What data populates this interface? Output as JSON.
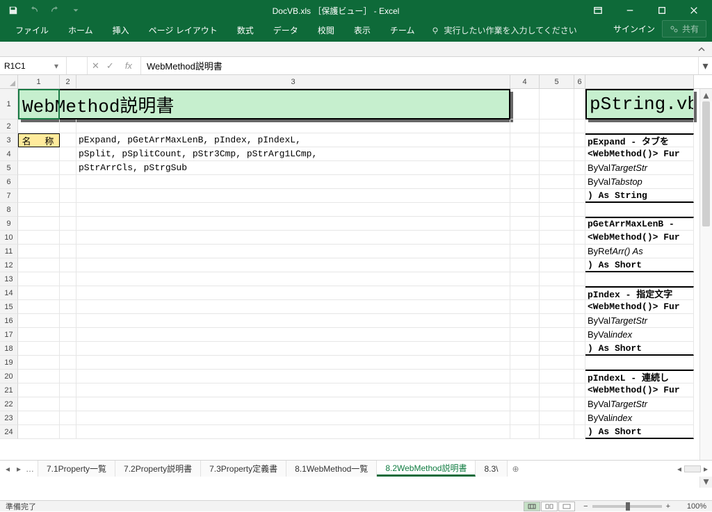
{
  "titlebar": {
    "title": "DocVB.xls ［保護ビュー］ - Excel"
  },
  "ribbon": {
    "tabs": [
      "ファイル",
      "ホーム",
      "挿入",
      "ページ レイアウト",
      "数式",
      "データ",
      "校閲",
      "表示",
      "チーム"
    ],
    "tellme": "実行したい作業を入力してください",
    "signin": "サインイン",
    "share": "共有"
  },
  "formula_bar": {
    "namebox": "R1C1",
    "formula": "WebMethod説明書"
  },
  "columns": [
    "1",
    "2",
    "3",
    "4",
    "5",
    "6"
  ],
  "row_headers": [
    "1",
    "2",
    "3",
    "4",
    "5",
    "6",
    "7",
    "8",
    "9",
    "10",
    "11",
    "12",
    "13",
    "14",
    "15",
    "16",
    "17",
    "18",
    "19",
    "20",
    "21",
    "22",
    "23",
    "24"
  ],
  "cells": {
    "title_left": "WebMethod説明書",
    "title_right": "pString.vb",
    "label_name": "名 称",
    "methods_line1": "pExpand, pGetArrMaxLenB, pIndex, pIndexL,",
    "methods_line2": "pSplit, pSplitCount, pStr3Cmp, pStrArg1LCmp,",
    "methods_line3": "pStrArrCls, pStrgSub"
  },
  "code_blocks": [
    {
      "rows": [
        {
          "t": "pExpand - タブを",
          "top": true,
          "bold": true
        },
        {
          "t": "<WebMethod()> Fur",
          "bold": true
        },
        {
          "t": "  ByVal TargetStr",
          "ital_from": 8
        },
        {
          "t": "  ByVal Tabstop",
          "ital_from": 8
        },
        {
          "t": ") As String",
          "bottom": true,
          "bold": true
        }
      ]
    },
    {
      "rows": [
        {
          "t": "pGetArrMaxLenB -",
          "top": true,
          "bold": true
        },
        {
          "t": "<WebMethod()> Fur",
          "bold": true
        },
        {
          "t": "  ByRef Arr()  As",
          "ital_from": 8
        },
        {
          "t": ") As Short",
          "bottom": true,
          "bold": true
        }
      ]
    },
    {
      "rows": [
        {
          "t": "pIndex - 指定文字",
          "top": true,
          "bold": true
        },
        {
          "t": "<WebMethod()> Fur",
          "bold": true
        },
        {
          "t": "  ByVal TargetStr",
          "ital_from": 8
        },
        {
          "t": "  ByVal index",
          "ital_from": 8
        },
        {
          "t": ") As Short",
          "bottom": true,
          "bold": true
        }
      ]
    },
    {
      "rows": [
        {
          "t": "pIndexL - 連続し",
          "top": true,
          "bold": true
        },
        {
          "t": "<WebMethod()> Fur",
          "bold": true
        },
        {
          "t": "  ByVal TargetStr",
          "ital_from": 8
        },
        {
          "t": "  ByVal index",
          "ital_from": 8
        },
        {
          "t": ") As Short",
          "bottom": true,
          "bold": true
        }
      ]
    }
  ],
  "sheet_tabs": {
    "tabs": [
      {
        "label": "7.1Property一覧"
      },
      {
        "label": "7.2Property説明書"
      },
      {
        "label": "7.3Property定義書"
      },
      {
        "label": "8.1WebMethod一覧"
      },
      {
        "label": "8.2WebMethod説明書",
        "active": true
      },
      {
        "label": "8.3\\"
      }
    ]
  },
  "statusbar": {
    "ready": "準備完了",
    "zoom": "100%"
  }
}
